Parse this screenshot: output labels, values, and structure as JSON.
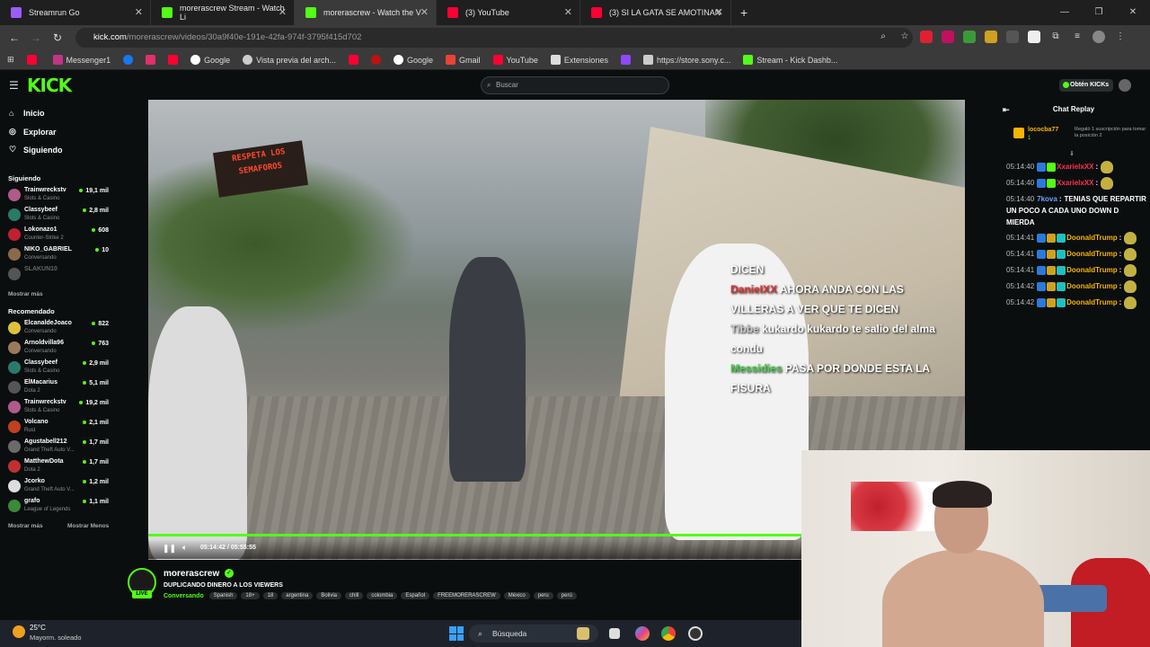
{
  "browser": {
    "tabs": [
      {
        "title": "Streamrun Go",
        "color": "#9b5cff"
      },
      {
        "title": "morerascrew Stream - Watch Li",
        "color": "#53fc18"
      },
      {
        "title": "morerascrew - Watch the V",
        "color": "#53fc18"
      },
      {
        "title": "(3) YouTube",
        "color": "#ff0033"
      },
      {
        "title": "(3) SI LA GATA SE AMOTINAN",
        "color": "#ff0033"
      }
    ],
    "url_host": "kick.com",
    "url_path": "/morerascrew/videos/30a9f40e-191e-42fa-974f-3795f415d702",
    "bookmarks": [
      {
        "label": "",
        "color": "#ff0033"
      },
      {
        "label": "Messenger1",
        "color": "#c13584"
      },
      {
        "label": "",
        "color": "#1877f2"
      },
      {
        "label": "",
        "color": "#e1306c"
      },
      {
        "label": "",
        "color": "#ff0033"
      },
      {
        "label": "Google",
        "color": "#ffffff"
      },
      {
        "label": "Vista previa del arch...",
        "color": "#ffffff"
      },
      {
        "label": "",
        "color": "#ff0033"
      },
      {
        "label": "",
        "color": "#c01010"
      },
      {
        "label": "Google",
        "color": "#ffffff"
      },
      {
        "label": "Gmail",
        "color": "#ea4335"
      },
      {
        "label": "YouTube",
        "color": "#ff0033"
      },
      {
        "label": "Extensiones",
        "color": "#dddddd"
      },
      {
        "label": "",
        "color": "#9146ff"
      },
      {
        "label": "https://store.sony.c...",
        "color": "#cccccc"
      },
      {
        "label": "Stream - Kick Dashb...",
        "color": "#53fc18"
      }
    ]
  },
  "kick": {
    "logo": "KICK",
    "search_placeholder": "Buscar",
    "kicks_button": "Obtén KICKs",
    "nav": [
      "Inicio",
      "Explorar",
      "Siguiendo"
    ],
    "following_title": "Siguiendo",
    "following": [
      {
        "name": "Trainwreckstv",
        "game": "Slots & Casino",
        "viewers": "19,1 mil",
        "color": "#b05a8a"
      },
      {
        "name": "Classybeef",
        "game": "Slots & Casino",
        "viewers": "2,8 mil",
        "color": "#2a7a6a"
      },
      {
        "name": "Lokonazo1",
        "game": "Counter-Strike 2",
        "viewers": "608",
        "color": "#c02030"
      },
      {
        "name": "NIKO_GABRIEL",
        "game": "Conversando",
        "viewers": "10",
        "color": "#8a6a4a"
      },
      {
        "name": "SLAKUN10",
        "game": "",
        "viewers": "",
        "color": "#555555"
      }
    ],
    "show_more": "Mostrar más",
    "recommended_title": "Recomendado",
    "recommended": [
      {
        "name": "ElcanaldeJoaco",
        "game": "Conversando",
        "viewers": "822",
        "color": "#e0c040"
      },
      {
        "name": "Arnoldvilla96",
        "game": "Conversando",
        "viewers": "763",
        "color": "#9a7a5a"
      },
      {
        "name": "Classybeef",
        "game": "Slots & Casino",
        "viewers": "2,9 mil",
        "color": "#2a7a6a"
      },
      {
        "name": "ElMacarius",
        "game": "Dota 2",
        "viewers": "5,1 mil",
        "color": "#555555"
      },
      {
        "name": "Trainwreckstv",
        "game": "Slots & Casino",
        "viewers": "19,2 mil",
        "color": "#b05a8a"
      },
      {
        "name": "Volcano",
        "game": "Rust",
        "viewers": "2,1 mil",
        "color": "#c04020"
      },
      {
        "name": "Agustabell212",
        "game": "Grand Theft Auto V...",
        "viewers": "1,7 mil",
        "color": "#6a6a6a"
      },
      {
        "name": "MatthewDota",
        "game": "Dota 2",
        "viewers": "1,7 mil",
        "color": "#c03030"
      },
      {
        "name": "Jcorko",
        "game": "Grand Theft Auto V...",
        "viewers": "1,2 mil",
        "color": "#dddddd"
      },
      {
        "name": "grafo",
        "game": "League of Legends",
        "viewers": "1,1 mil",
        "color": "#3a8a3a"
      }
    ],
    "show_more2": "Mostrar más",
    "show_less": "Mostrar Menos"
  },
  "video": {
    "sign_text": "RESPETA LOS SEMAFOROS",
    "overlay": [
      {
        "user": "",
        "text": "DICEN"
      },
      {
        "user": "DanieIXX",
        "text": "AHORA ANDA CON LAS VILLERAS A VER QUE TE DICEN",
        "color": "u1"
      },
      {
        "user": "Tibbe",
        "text": "kukardo kukardo te salio del alma condu",
        "color": "u2"
      },
      {
        "user": "Messidies",
        "text": "PASA POR DONDE ESTA LA FISURA",
        "color": "u3"
      }
    ],
    "time": "05:14:42 / 05:55:55",
    "progress": 0.8
  },
  "stream": {
    "channel": "morerascrew",
    "title": "DUPLICANDO DINERO A LOS VIEWERS",
    "live": "LIVE",
    "category": "Conversando",
    "tags": [
      "Spanish",
      "18+",
      "18",
      "argentina",
      "Bolivia",
      "chill",
      "colombia",
      "Español",
      "FREEMORERASCREW",
      "México",
      "peru",
      "perú"
    ]
  },
  "chat": {
    "title": "Chat Replay",
    "pinned_user": "lococba77",
    "pinned_level": "1",
    "pinned_text": "Regaló 1 suscripción para tomar la posición 2",
    "messages": [
      {
        "time": "05:14:40",
        "user": "XxarielxXX",
        "text": "",
        "color": "#ff3050",
        "emote": true
      },
      {
        "time": "05:14:40",
        "user": "XxarielxXX",
        "text": "",
        "color": "#ff3050",
        "emote": true
      },
      {
        "time": "05:14:40",
        "user": "7kova",
        "text": "TENIAS QUE REPARTIR UN POCO A CADA UNO DOWN D MIERDA",
        "color": "#6aa0ff",
        "emote": false
      },
      {
        "time": "05:14:41",
        "user": "DoonaldTrump",
        "text": "",
        "color": "#f5b400",
        "emote": true
      },
      {
        "time": "05:14:41",
        "user": "DoonaldTrump",
        "text": "",
        "color": "#f5b400",
        "emote": true
      },
      {
        "time": "05:14:41",
        "user": "DoonaldTrump",
        "text": "",
        "color": "#f5b400",
        "emote": true
      },
      {
        "time": "05:14:42",
        "user": "DoonaldTrump",
        "text": "",
        "color": "#f5b400",
        "emote": true
      },
      {
        "time": "05:14:42",
        "user": "DoonaldTrump",
        "text": "",
        "color": "#f5b400",
        "emote": true
      }
    ]
  },
  "taskbar": {
    "temp": "25°C",
    "weather": "Mayorm. soleado",
    "search": "Búsqueda"
  }
}
